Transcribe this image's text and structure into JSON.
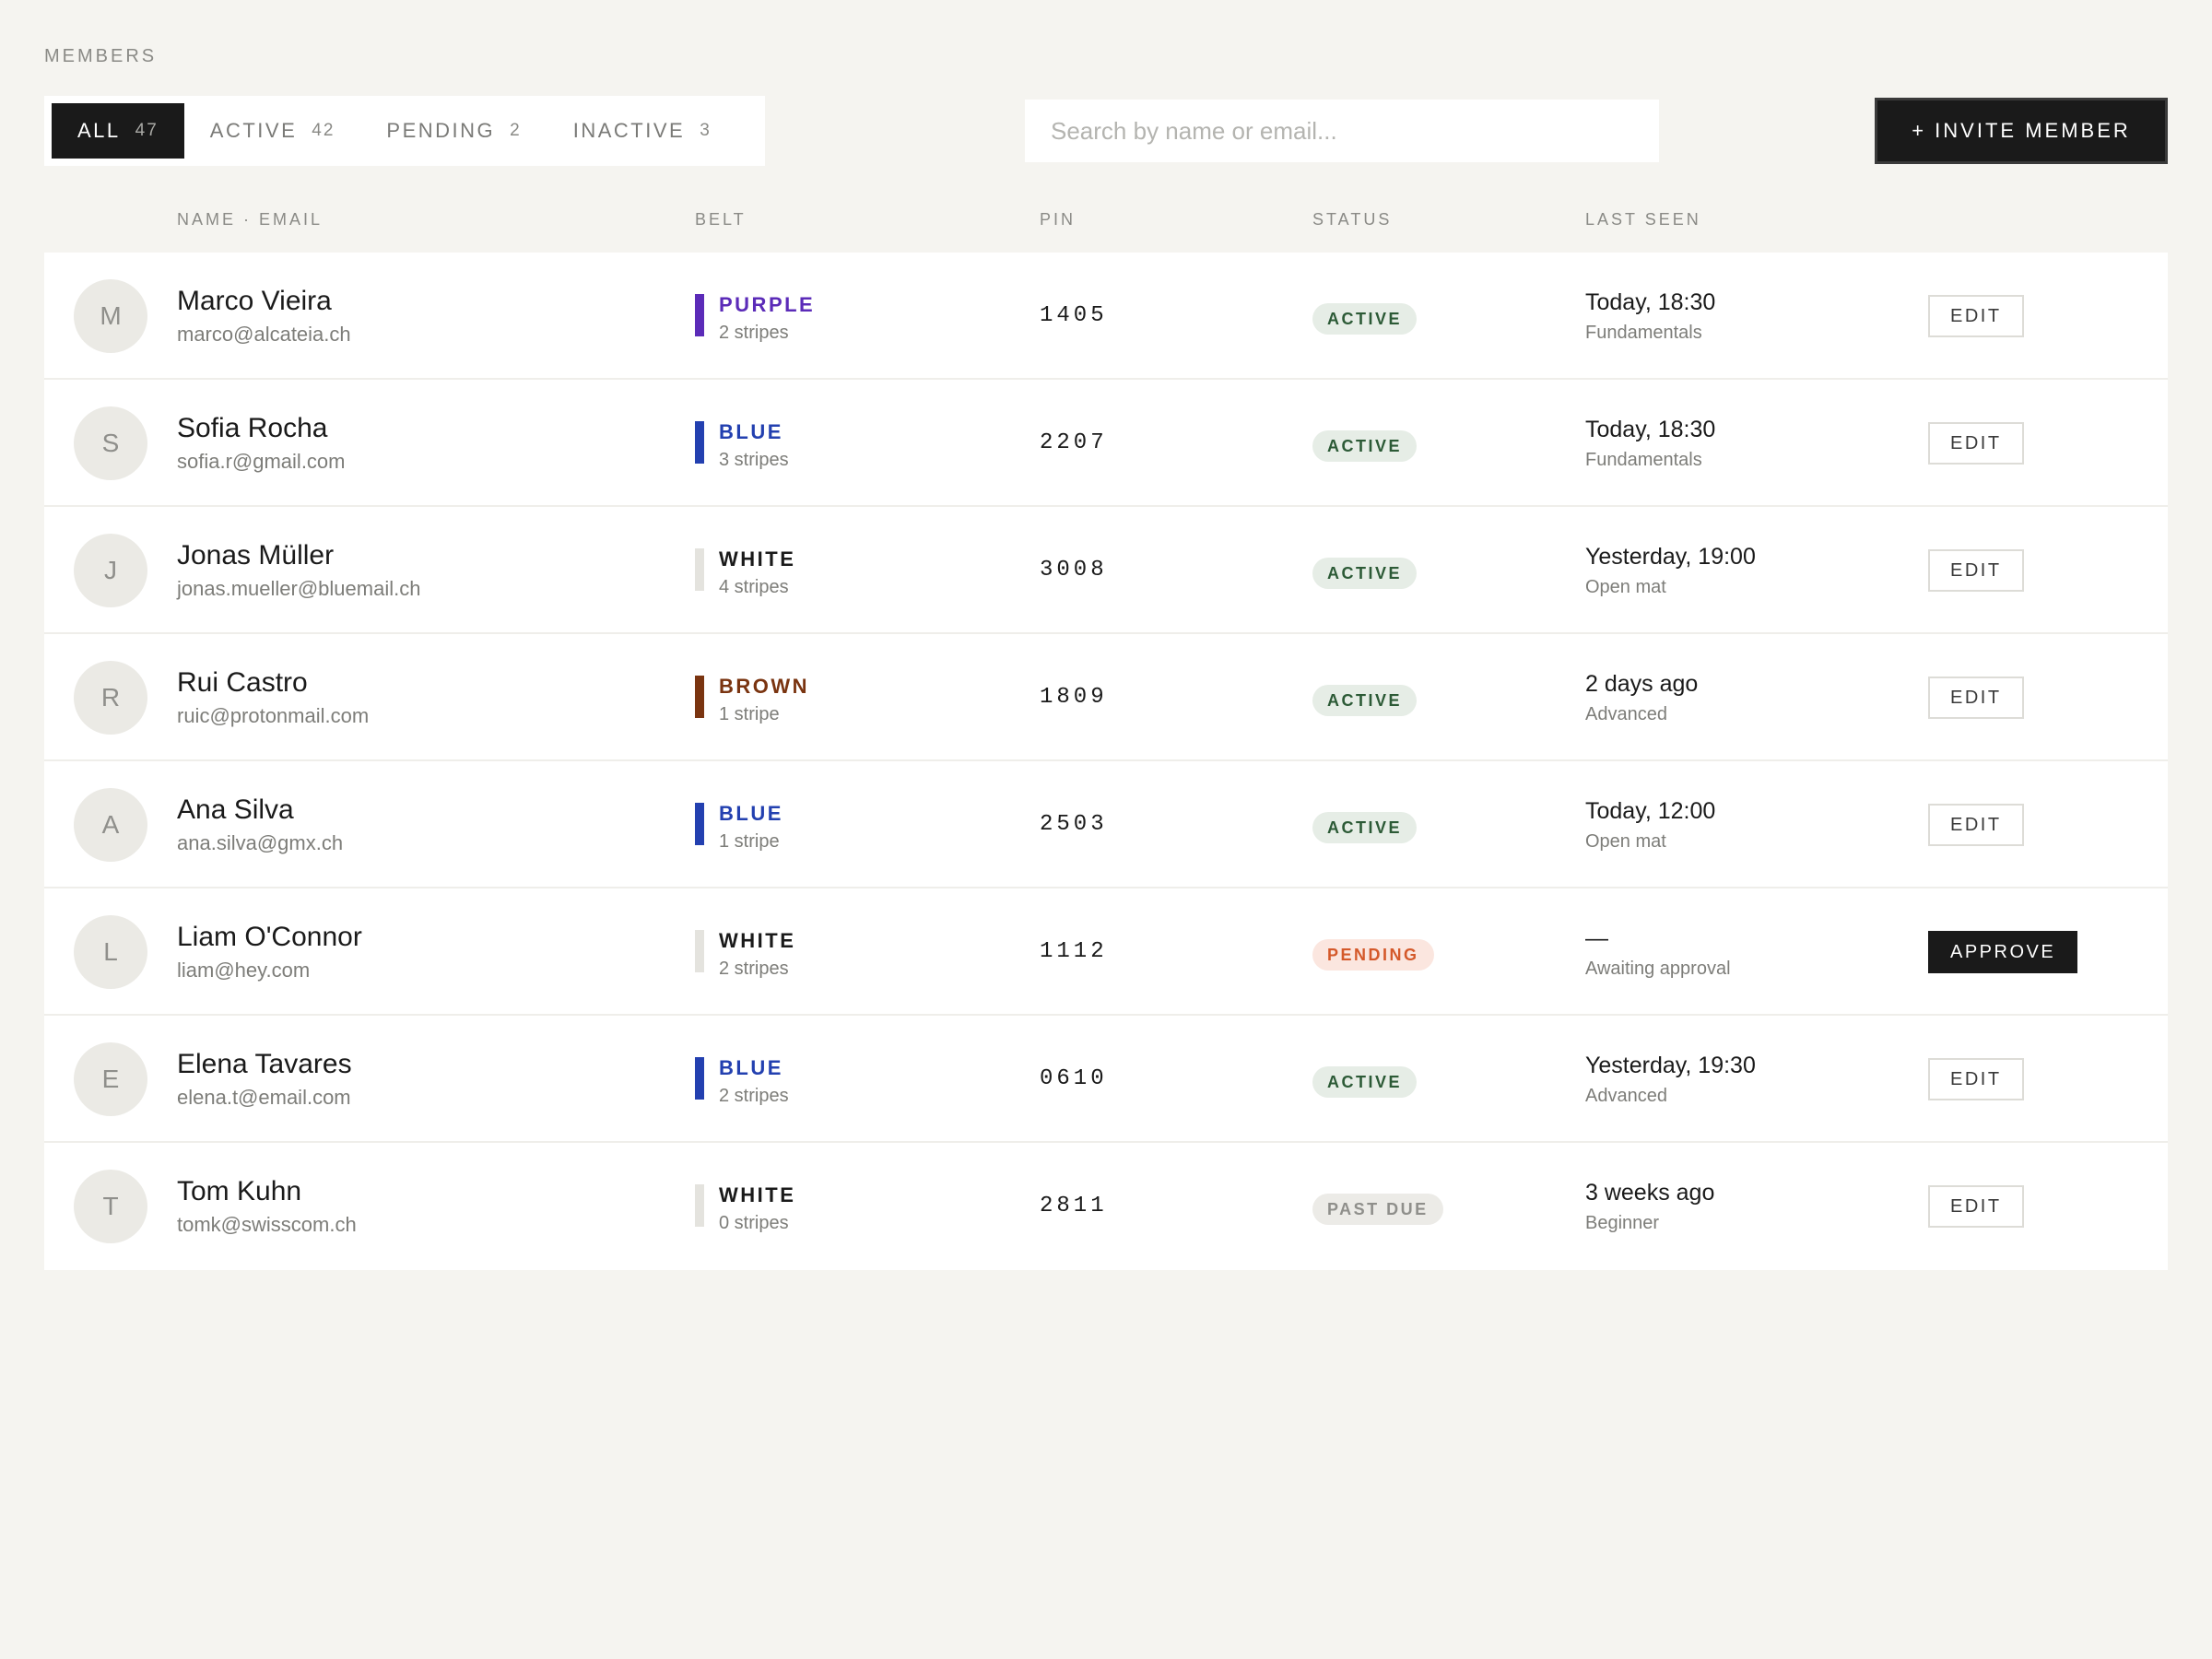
{
  "section_label": "MEMBERS",
  "tabs": [
    {
      "label": "ALL",
      "count": "47"
    },
    {
      "label": "ACTIVE",
      "count": "42"
    },
    {
      "label": "PENDING",
      "count": "2"
    },
    {
      "label": "INACTIVE",
      "count": "3"
    }
  ],
  "search": {
    "placeholder": "Search by name or email..."
  },
  "invite_label": "+ INVITE MEMBER",
  "columns": {
    "name_email": "NAME · EMAIL",
    "belt": "BELT",
    "pin": "PIN",
    "status": "STATUS",
    "last_seen": "LAST SEEN"
  },
  "colors": {
    "purple": "#5b2bb8",
    "blue": "#2340b0",
    "white_bar": "#e4e3de",
    "white_text": "#1a1a1a",
    "brown": "#7a3410"
  },
  "members": [
    {
      "initial": "M",
      "name": "Marco Vieira",
      "email": "marco@alcateia.ch",
      "belt": "PURPLE",
      "belt_key": "purple",
      "stripes": "2 stripes",
      "pin": "1405",
      "status": "ACTIVE",
      "status_key": "active",
      "last_seen": "Today, 18:30",
      "class": "Fundamentals",
      "action": "EDIT"
    },
    {
      "initial": "S",
      "name": "Sofia Rocha",
      "email": "sofia.r@gmail.com",
      "belt": "BLUE",
      "belt_key": "blue",
      "stripes": "3 stripes",
      "pin": "2207",
      "status": "ACTIVE",
      "status_key": "active",
      "last_seen": "Today, 18:30",
      "class": "Fundamentals",
      "action": "EDIT"
    },
    {
      "initial": "J",
      "name": "Jonas Müller",
      "email": "jonas.mueller@bluemail.ch",
      "belt": "WHITE",
      "belt_key": "white",
      "stripes": "4 stripes",
      "pin": "3008",
      "status": "ACTIVE",
      "status_key": "active",
      "last_seen": "Yesterday, 19:00",
      "class": "Open mat",
      "action": "EDIT"
    },
    {
      "initial": "R",
      "name": "Rui Castro",
      "email": "ruic@protonmail.com",
      "belt": "BROWN",
      "belt_key": "brown",
      "stripes": "1 stripe",
      "pin": "1809",
      "status": "ACTIVE",
      "status_key": "active",
      "last_seen": "2 days ago",
      "class": "Advanced",
      "action": "EDIT"
    },
    {
      "initial": "A",
      "name": "Ana Silva",
      "email": "ana.silva@gmx.ch",
      "belt": "BLUE",
      "belt_key": "blue",
      "stripes": "1 stripe",
      "pin": "2503",
      "status": "ACTIVE",
      "status_key": "active",
      "last_seen": "Today, 12:00",
      "class": "Open mat",
      "action": "EDIT"
    },
    {
      "initial": "L",
      "name": "Liam O'Connor",
      "email": "liam@hey.com",
      "belt": "WHITE",
      "belt_key": "white",
      "stripes": "2 stripes",
      "pin": "1112",
      "status": "PENDING",
      "status_key": "pending",
      "last_seen": "—",
      "class": "Awaiting approval",
      "action": "APPROVE"
    },
    {
      "initial": "E",
      "name": "Elena Tavares",
      "email": "elena.t@email.com",
      "belt": "BLUE",
      "belt_key": "blue",
      "stripes": "2 stripes",
      "pin": "0610",
      "status": "ACTIVE",
      "status_key": "active",
      "last_seen": "Yesterday, 19:30",
      "class": "Advanced",
      "action": "EDIT"
    },
    {
      "initial": "T",
      "name": "Tom Kuhn",
      "email": "tomk@swisscom.ch",
      "belt": "WHITE",
      "belt_key": "white",
      "stripes": "0 stripes",
      "pin": "2811",
      "status": "PAST DUE",
      "status_key": "pastdue",
      "last_seen": "3 weeks ago",
      "class": "Beginner",
      "action": "EDIT"
    }
  ]
}
